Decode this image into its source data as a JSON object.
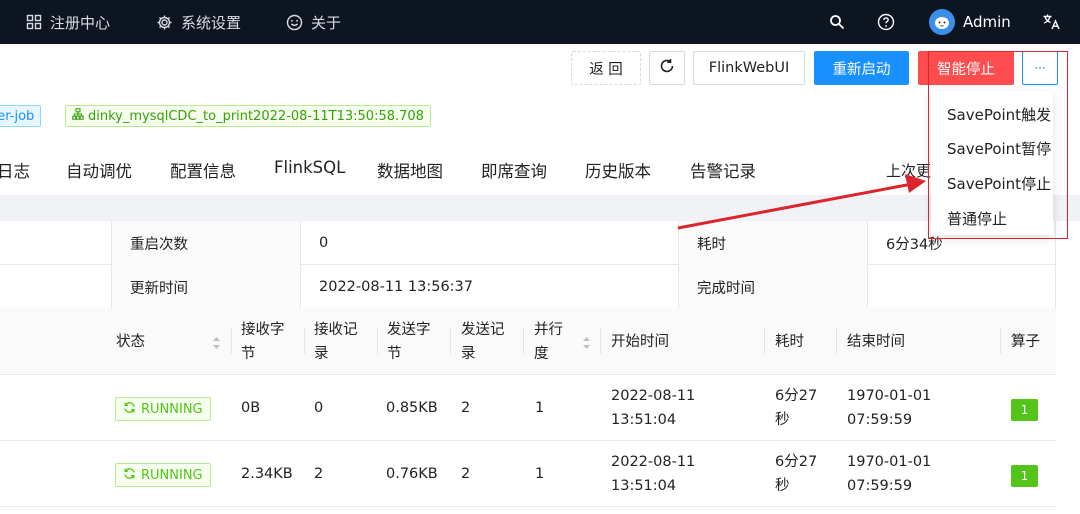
{
  "topbar": {
    "nav_register": "注册中心",
    "nav_settings": "系统设置",
    "nav_about": "关于",
    "user_name": "Admin"
  },
  "toolbar": {
    "back": "返 回",
    "flink_web_ui": "FlinkWebUI",
    "restart": "重新启动",
    "smart_stop": "智能停止",
    "more": "···"
  },
  "tags": {
    "type": "per-job",
    "job_name": "dinky_mysqlCDC_to_print2022-08-11T13:50:58.708"
  },
  "tabs": [
    "日志",
    "自动调优",
    "配置信息",
    "FlinkSQL",
    "数据地图",
    "即席查询",
    "历史版本",
    "告警记录"
  ],
  "last_update_prefix": "上次更",
  "dropdown": {
    "items": [
      "SavePoint触发",
      "SavePoint暂停",
      "SavePoint停止",
      "普通停止"
    ]
  },
  "info": {
    "restart_count_label": "重启次数",
    "restart_count_value": "0",
    "duration_label": "耗时",
    "duration_value": "6分34秒",
    "update_time_label": "更新时间",
    "update_time_value": "2022-08-11 13:56:37",
    "finish_time_label": "完成时间",
    "finish_time_value": ""
  },
  "table": {
    "headers": {
      "status": "状态",
      "recv_bytes_1": "接收字",
      "recv_bytes_2": "节",
      "recv_records_1": "接收记",
      "recv_records_2": "录",
      "send_bytes_1": "发送字",
      "send_bytes_2": "节",
      "send_records_1": "发送记",
      "send_records_2": "录",
      "parallel_1": "并行",
      "parallel_2": "度",
      "start_time": "开始时间",
      "duration": "耗时",
      "end_time": "结束时间",
      "operator": "算子"
    },
    "rows": [
      {
        "status": "RUNNING",
        "recv_bytes": "0B",
        "recv_records": "0",
        "send_bytes": "0.85KB",
        "send_records": "2",
        "parallel": "1",
        "start_date": "2022-08-11",
        "start_clock": "13:51:04",
        "duration_1": "6分27",
        "duration_2": "秒",
        "end_date": "1970-01-01",
        "end_clock": "07:59:59",
        "operator": "1"
      },
      {
        "status": "RUNNING",
        "recv_bytes": "2.34KB",
        "recv_records": "2",
        "send_bytes": "0.76KB",
        "send_records": "2",
        "parallel": "1",
        "start_date": "2022-08-11",
        "start_clock": "13:51:04",
        "duration_1": "6分27",
        "duration_2": "秒",
        "end_date": "1970-01-01",
        "end_clock": "07:59:59",
        "operator": "1"
      }
    ]
  },
  "colors": {
    "topbar_bg": "#0d1521",
    "primary": "#1890ff",
    "danger": "#ff4d4f",
    "success": "#52c41a",
    "annotation_red": "#d9252b"
  }
}
